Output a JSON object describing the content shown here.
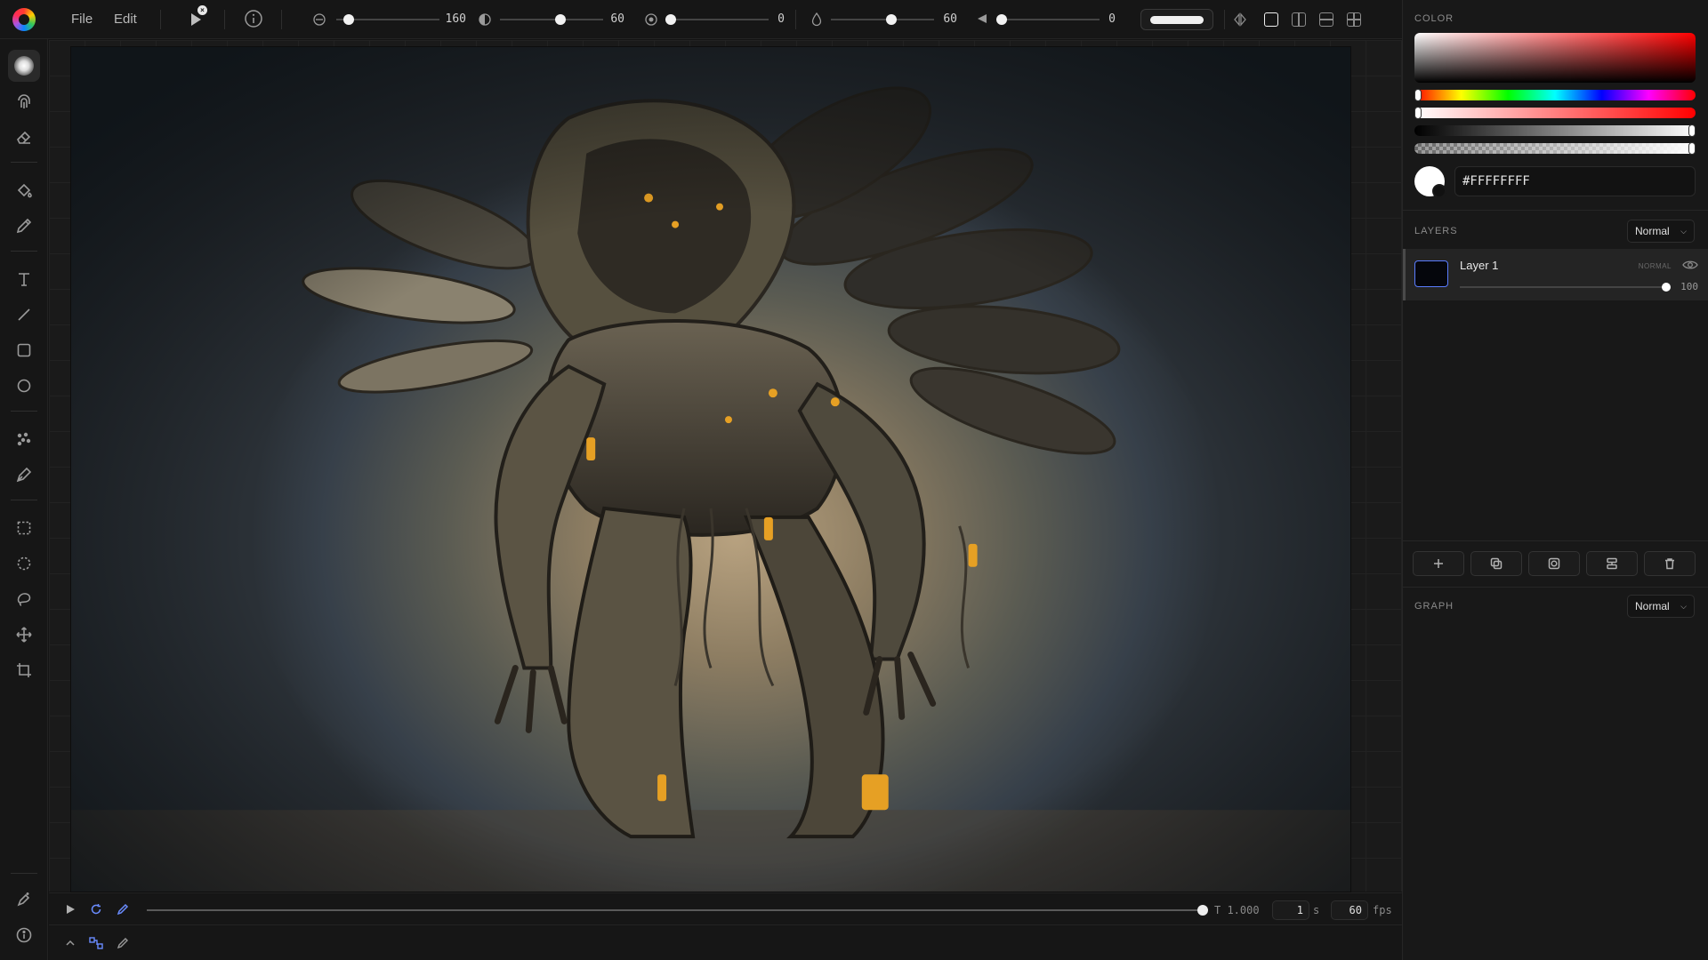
{
  "menu": {
    "file": "File",
    "edit": "Edit"
  },
  "toolbar": {
    "size_value": "160",
    "size_fraction": 0.08,
    "opacity_value": "60",
    "opacity_fraction": 0.6,
    "hardness_value": "0",
    "hardness_fraction": 0.0,
    "flow_value": "60",
    "flow_fraction": 0.6,
    "spacing_value": "0",
    "spacing_fraction": 0.0
  },
  "left_tools": [
    "brush",
    "smudge",
    "eraser",
    "fill",
    "eyedropper",
    "text",
    "line",
    "rectangle",
    "ellipse",
    "scatter",
    "pen",
    "rect-select",
    "ellipse-select",
    "lasso",
    "move",
    "crop"
  ],
  "timeline": {
    "time_label": "T 1.000",
    "duration_value": "1",
    "duration_unit": "s",
    "fps_value": "60",
    "fps_unit": "fps",
    "progress": 1.0
  },
  "color": {
    "title": "COLOR",
    "hex": "#FFFFFFFF",
    "current": "#FFFFFF"
  },
  "layers": {
    "title": "LAYERS",
    "blend_mode": "Normal",
    "items": [
      {
        "name": "Layer 1",
        "blend": "NORMAL",
        "opacity": "100"
      }
    ]
  },
  "graph": {
    "title": "GRAPH",
    "mode": "Normal"
  }
}
